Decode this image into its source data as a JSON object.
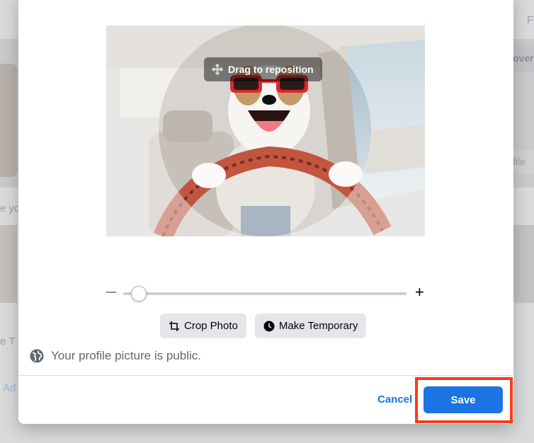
{
  "photo": {
    "reposition_label": "Drag to reposition"
  },
  "zoom": {
    "minus_label": "–",
    "plus_label": "+",
    "level": 0.03
  },
  "actions": {
    "crop_label": "Crop Photo",
    "temporary_label": "Make Temporary"
  },
  "privacy": {
    "text": "Your profile picture is public."
  },
  "footer": {
    "cancel_label": "Cancel",
    "save_label": "Save"
  },
  "background": {
    "top_right_fragment": "F",
    "right_fragment_1": "over",
    "right_fragment_2": "file",
    "left_fragment_1": "e yo",
    "left_fragment_2": "e T",
    "left_fragment_3": "Ad"
  },
  "colors": {
    "primary": "#1b74e4",
    "highlight_frame": "#f43d1a",
    "secondary_button": "#e4e6eb"
  }
}
